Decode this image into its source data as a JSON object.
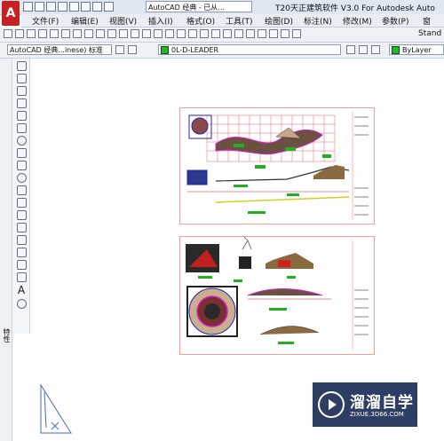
{
  "window": {
    "title": "T20天正建筑软件 V3.0 For Autodesk Auto",
    "workspace": "AutoCAD 经典 - 已从..."
  },
  "menu": [
    {
      "label": "文件(F)"
    },
    {
      "label": "编辑(E)"
    },
    {
      "label": "视图(V)"
    },
    {
      "label": "插入(I)"
    },
    {
      "label": "格式(O)"
    },
    {
      "label": "工具(T)"
    },
    {
      "label": "绘图(D)"
    },
    {
      "label": "标注(N)"
    },
    {
      "label": "修改(M)"
    },
    {
      "label": "参数(P)"
    },
    {
      "label": "窗"
    }
  ],
  "toolbar1": {
    "style_name": "Stand"
  },
  "toolbar2": {
    "workspace_combo": "AutoCAD 经典...inese) 标准",
    "layer_combo": "0L-D-LEADER",
    "linetype_combo": "ByLayer",
    "layer_color": "#19c219"
  },
  "left_panel": {
    "label": "特性"
  },
  "drawtools": {
    "text_tool": "A"
  },
  "watermark": {
    "name": "溜溜自学",
    "url": "ZIXUE.3D66.COM"
  },
  "colors": {
    "accent_red": "#c62020",
    "sheet_border": "#ff9a9a",
    "watermark_bg": "#2e3d63"
  }
}
